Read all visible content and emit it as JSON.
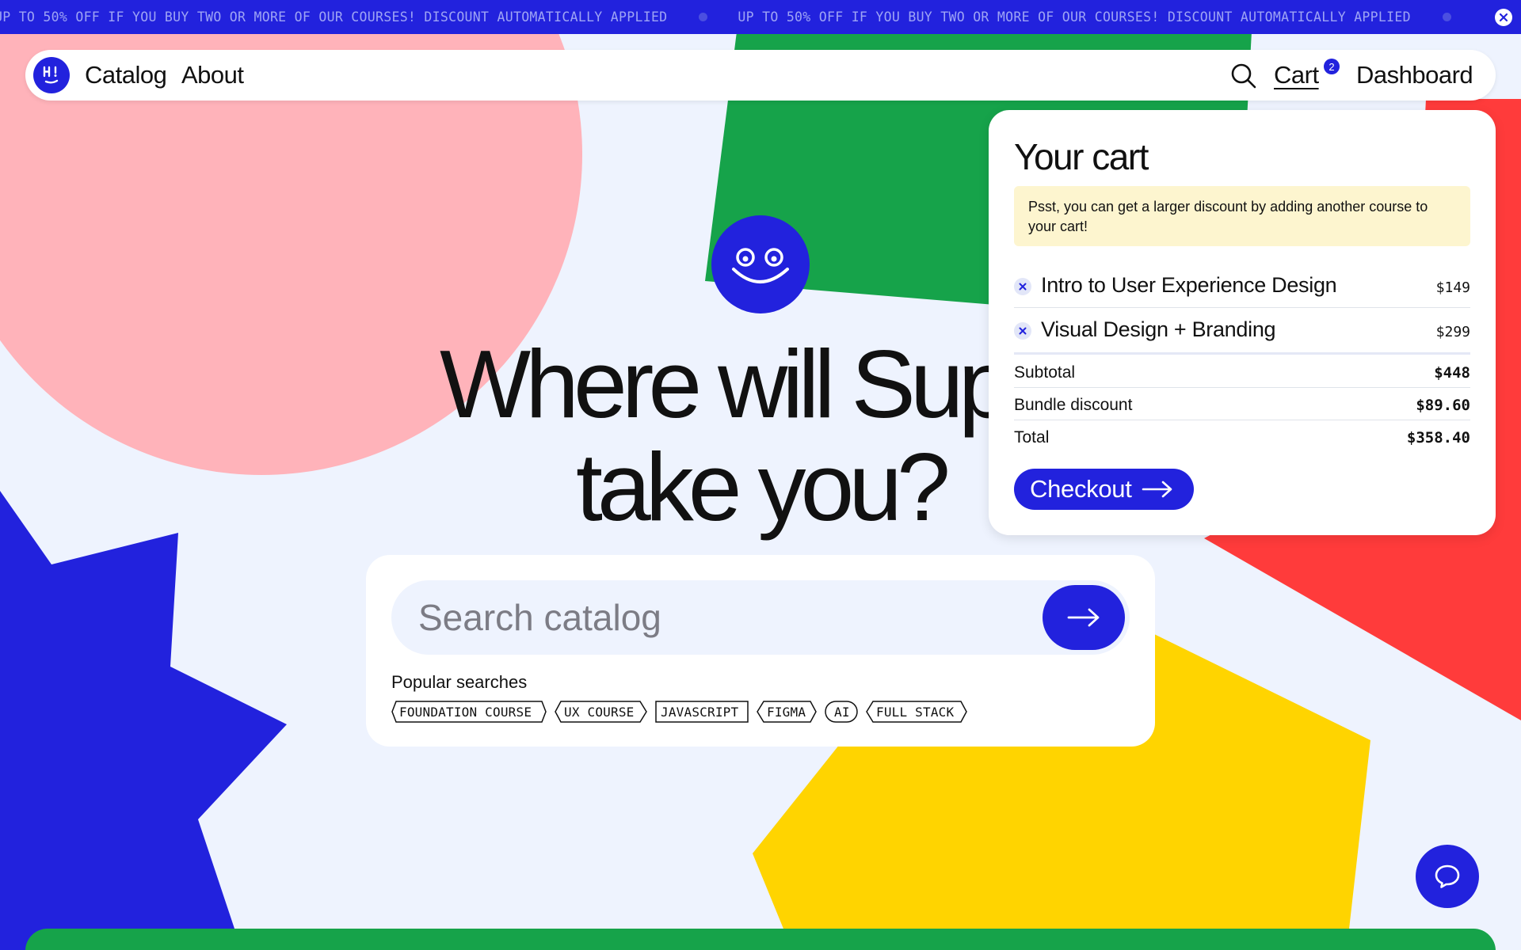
{
  "announcement": {
    "message_1": "UP TO 50% OFF IF YOU BUY TWO OR MORE OF OUR COURSES! DISCOUNT AUTOMATICALLY APPLIED",
    "message_2": "UP TO 50% OFF IF YOU BUY TWO OR MORE OF OUR COURSES! DISCOUNT AUTOMATICALLY APPLIED",
    "close_icon": "close-icon"
  },
  "nav": {
    "logo_icon": "hi-logo-icon",
    "catalog": "Catalog",
    "about": "About",
    "search_icon": "search-icon",
    "cart": "Cart",
    "cart_count": "2",
    "dashboard": "Dashboard"
  },
  "hero": {
    "headline_line1": "Where will Super",
    "headline_line2": "take you?",
    "mascot_icon": "smiley-face-icon"
  },
  "search": {
    "placeholder": "Search catalog",
    "value": "",
    "submit_icon": "arrow-right-icon",
    "popular_label": "Popular searches",
    "tags": [
      "FOUNDATION COURSE",
      "UX COURSE",
      "JAVASCRIPT",
      "FIGMA",
      "AI",
      "FULL STACK"
    ]
  },
  "cart": {
    "title": "Your cart",
    "notice": "Psst, you can get a larger discount by adding another course to your cart!",
    "items": [
      {
        "name": "Intro to User Experience Design",
        "price": "$149"
      },
      {
        "name": "Visual Design + Branding",
        "price": "$299"
      }
    ],
    "subtotal_label": "Subtotal",
    "subtotal_value": "$448",
    "discount_label": "Bundle discount",
    "discount_value": "$89.60",
    "total_label": "Total",
    "total_value": "$358.40",
    "checkout_label": "Checkout"
  },
  "chat": {
    "icon": "chat-bubble-icon"
  },
  "colors": {
    "brand_blue": "#2222dd",
    "pink": "#ffb3ba",
    "green": "#16a34a",
    "red": "#ff3b3b",
    "yellow": "#ffd400",
    "background": "#eef3fe",
    "notice_bg": "#fdf5cf"
  }
}
